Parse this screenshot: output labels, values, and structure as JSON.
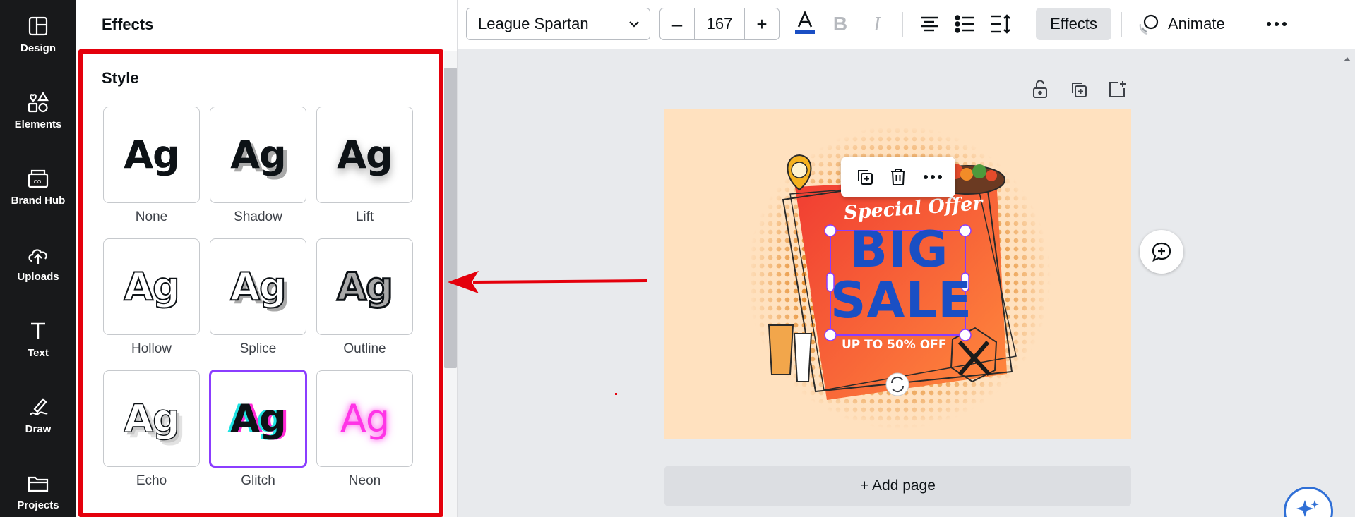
{
  "sidebar": {
    "items": [
      {
        "label": "Design",
        "icon": "design-icon"
      },
      {
        "label": "Elements",
        "icon": "elements-icon"
      },
      {
        "label": "Brand Hub",
        "icon": "brand-hub-icon"
      },
      {
        "label": "Uploads",
        "icon": "uploads-icon"
      },
      {
        "label": "Text",
        "icon": "text-icon"
      },
      {
        "label": "Draw",
        "icon": "draw-icon"
      },
      {
        "label": "Projects",
        "icon": "projects-icon"
      }
    ]
  },
  "panel": {
    "title": "Effects",
    "section_heading": "Style",
    "styles": [
      {
        "label": "None",
        "sample": "Ag"
      },
      {
        "label": "Shadow",
        "sample": "Ag"
      },
      {
        "label": "Lift",
        "sample": "Ag"
      },
      {
        "label": "Hollow",
        "sample": "Ag"
      },
      {
        "label": "Splice",
        "sample": "Ag"
      },
      {
        "label": "Outline",
        "sample": "Ag"
      },
      {
        "label": "Echo",
        "sample": "Ag"
      },
      {
        "label": "Glitch",
        "sample": "Ag",
        "selected": true
      },
      {
        "label": "Neon",
        "sample": "Ag"
      }
    ]
  },
  "toolbar": {
    "font_name": "League Spartan",
    "font_size": "167",
    "decrease_label": "–",
    "increase_label": "+",
    "text_color": "#1a4fc4",
    "effects_label": "Effects",
    "animate_label": "Animate"
  },
  "artboard": {
    "special_offer": "Special Offer",
    "headline_line1": "BIG",
    "headline_line2": "SALE",
    "subline": "UP TO 50% OFF"
  },
  "canvas": {
    "add_page_label": "+ Add page"
  },
  "colors": {
    "highlight": "#e4000c",
    "selected_accent": "#8b3dff",
    "rail_bg": "#18191b",
    "artboard_bg": "#ffe1bf"
  }
}
